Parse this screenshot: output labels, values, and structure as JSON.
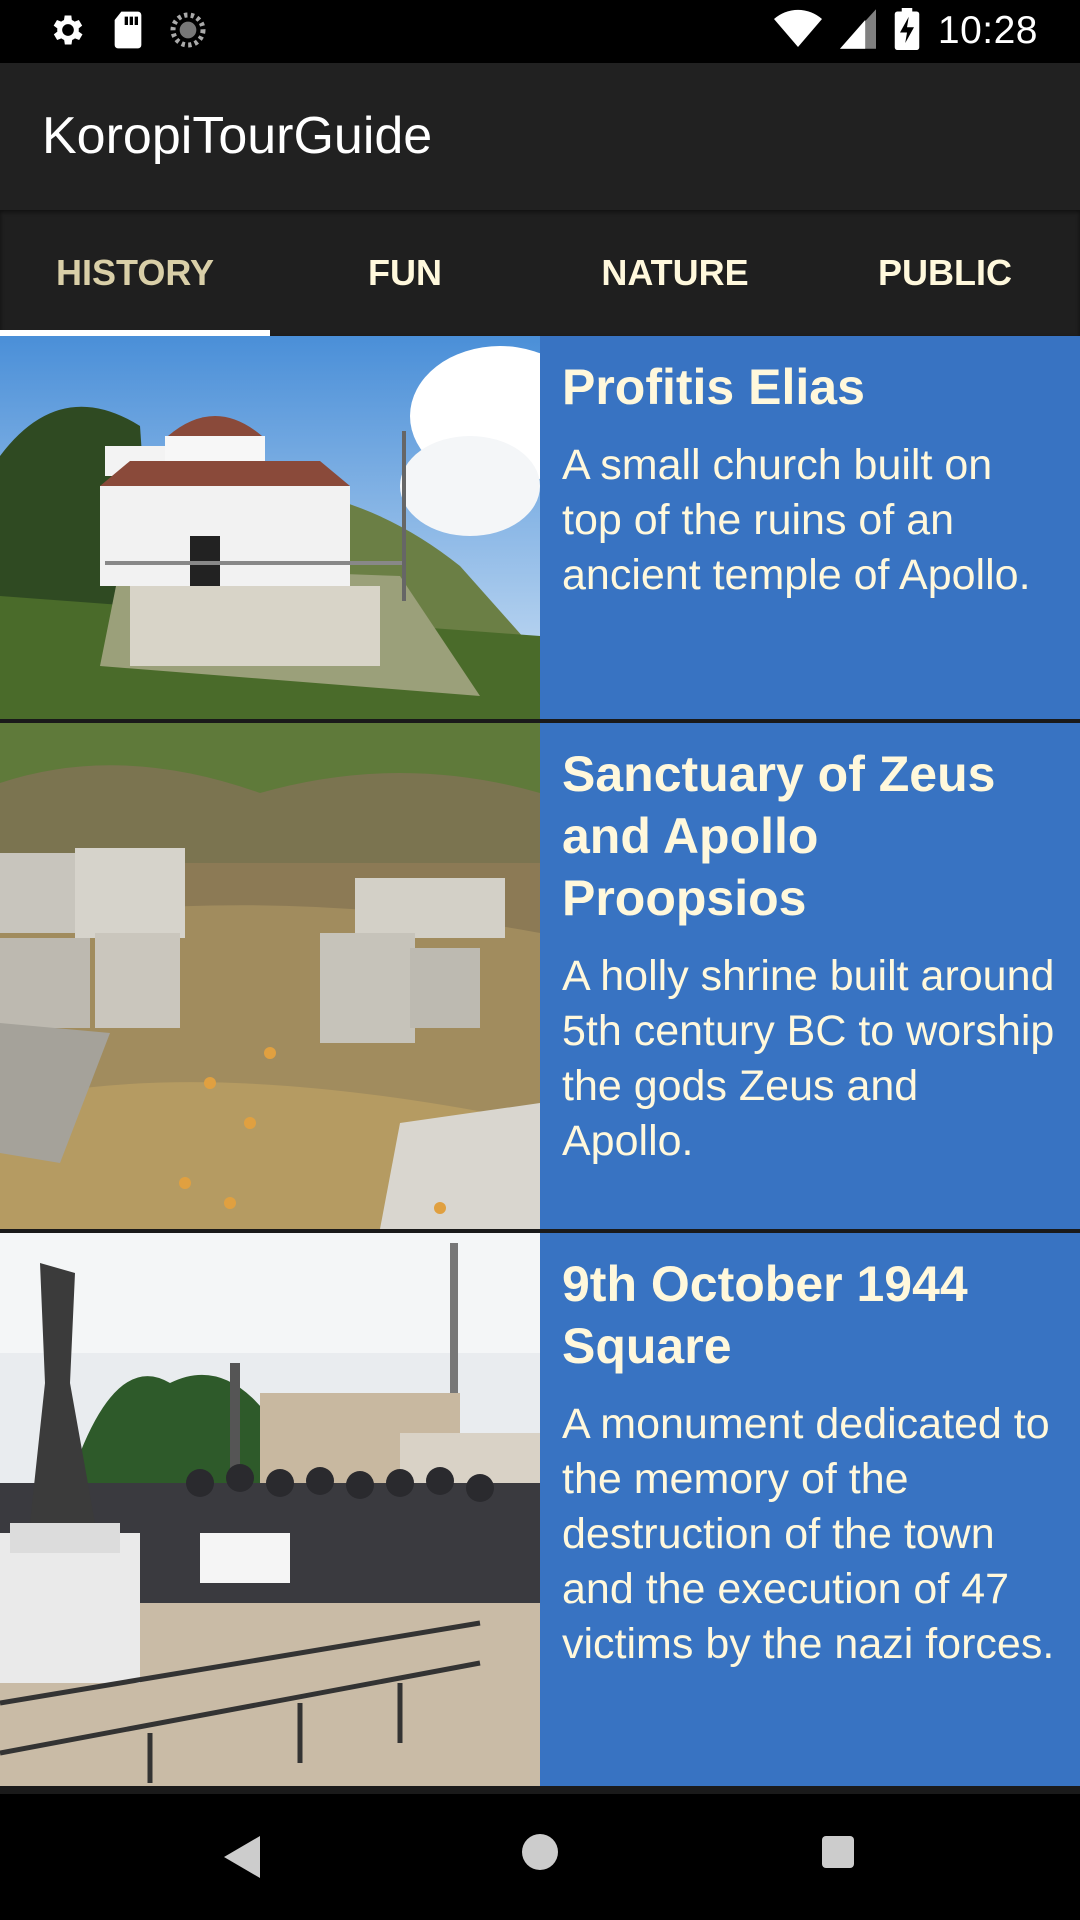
{
  "status_bar": {
    "time": "10:28",
    "left_icons": [
      "settings-icon",
      "sd-card-icon",
      "sync-icon"
    ],
    "right_icons": [
      "wifi-icon",
      "signal-icon",
      "battery-charging-icon"
    ]
  },
  "app_bar": {
    "title": "KoropiTourGuide"
  },
  "tabs": [
    {
      "label": "HISTORY",
      "active": true
    },
    {
      "label": "FUN",
      "active": false
    },
    {
      "label": "NATURE",
      "active": false
    },
    {
      "label": "PUBLIC",
      "active": false
    }
  ],
  "items": [
    {
      "title": "Profitis Elias",
      "description": "A small church built on top of the ruins of an ancient temple of Apollo.",
      "image": "church-on-hill-photo"
    },
    {
      "title": "Sanctuary of Zeus and Apollo Proopsios",
      "description": "A holly shrine built around 5th century BC to worship the gods Zeus and Apollo.",
      "image": "ancient-stone-ruins-photo"
    },
    {
      "title": "9th October 1944 Square",
      "description": "A monument dedicated to the memory of the destruction of the town and the execution of 47 victims by the nazi forces.",
      "image": "monument-ceremony-photo"
    }
  ],
  "nav_bar": {
    "buttons": [
      "back-icon",
      "home-icon",
      "recents-icon"
    ]
  },
  "colors": {
    "panel": "#3873c2",
    "text_cream": "#fff8dc",
    "app_bar": "#212121"
  }
}
